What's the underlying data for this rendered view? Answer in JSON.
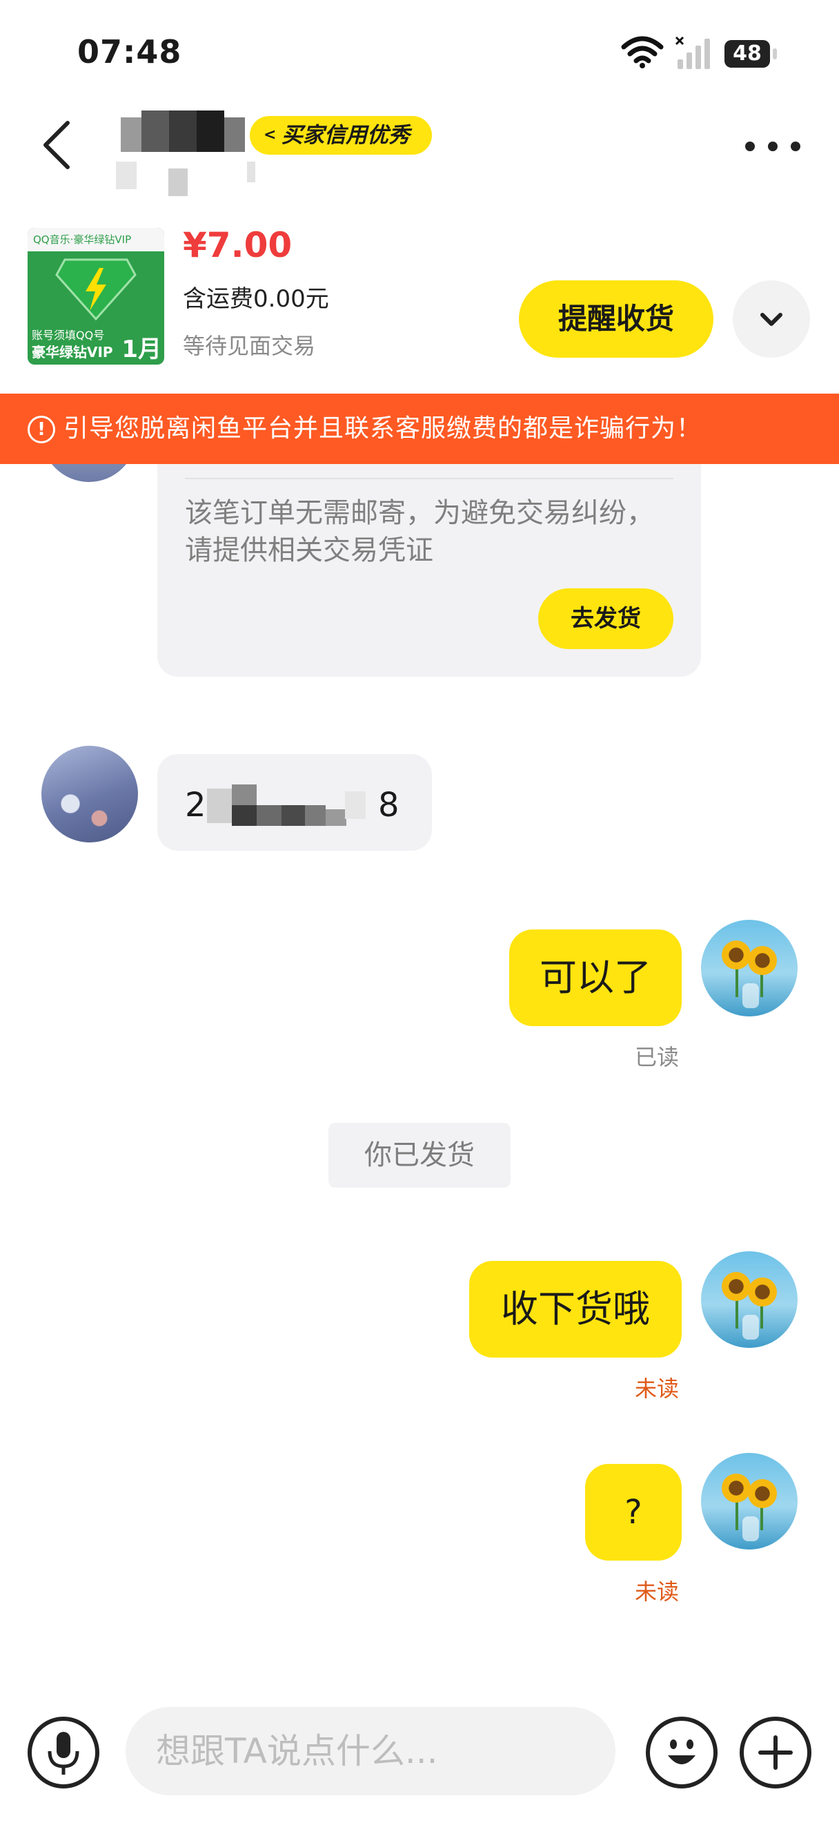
{
  "status_bar": {
    "time": "07:48",
    "battery": "48"
  },
  "header": {
    "credit_badge": "买家信用优秀"
  },
  "product": {
    "thumb_top_text": "QQ音乐·豪华绿钻VIP",
    "thumb_bottom_text": "账号须填QQ号",
    "thumb_vip_text": "豪华绿钻VIP",
    "thumb_duration": "1月",
    "price": "¥7.00",
    "shipping": "含运费0.00元",
    "status": "等待见面交易",
    "remind_button": "提醒收货"
  },
  "warning_text": "引导您脱离闲鱼平台并且联系客服缴费的都是诈骗行为！",
  "order_card": {
    "note": "该笔订单无需邮寄，为避免交易纠纷，请提供相关交易凭证",
    "ship_button": "去发货"
  },
  "messages": {
    "incoming_first": "2",
    "incoming_last": "8",
    "out1": "可以了",
    "out1_status": "已读",
    "system": "你已发货",
    "out2": "收下货哦",
    "out2_status": "未读",
    "out3": "?",
    "out3_status": "未读"
  },
  "input": {
    "placeholder": "想跟TA说点什么..."
  },
  "colors": {
    "accent_yellow": "#ffe40f",
    "warning_orange": "#ff5a23",
    "price_red": "#ef3c3c",
    "unread_orange": "#e05a18"
  }
}
